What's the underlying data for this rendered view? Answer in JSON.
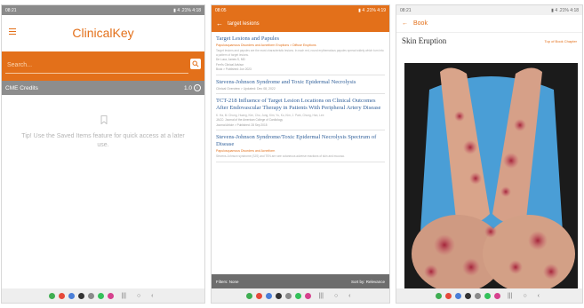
{
  "screen_home": {
    "status_time": "08:21",
    "status_right": "▮ 4 .21% 4:18",
    "title": "ClinicalKey",
    "search_placeholder": "Search...",
    "cme_label": "CME Credits",
    "cme_value": "1.0",
    "tip": "Tip! Use the Saved Items feature for quick access at a later use."
  },
  "screen_results": {
    "status_time": "08:05",
    "status_right": "▮ 4 .21% 4:19",
    "query": "target lesions",
    "results": [
      {
        "title": "Target Lesions and Papules",
        "meta": "Papulosquamous Disorders and Acneiform Eruptions > Diffuse Eruptions",
        "text": "Target lesions and papules are the most characteristic lesions. In each red, round erythematous papules spread widely which turn into a pattern of target lesions.",
        "author": "De Luca, James S, MD",
        "source": "Ferri's Clinical Advisor",
        "date": "Book > Published: Jun 2023"
      },
      {
        "title": "Stevens-Johnson Syndrome and Toxic Epidermal Necrolysis",
        "meta": "Clinical Overview > Updated: Dec 08, 2022"
      },
      {
        "title": "TCT-218 Influence of Target Lesion Locations on Clinical Outcomes After Endovascular Therapy in Patients With Peripheral Artery Disease",
        "text": "K. Ha, M. Chung, Huang, Kim, Cho, Jung, Kim, Yu, Ko, Kim, J. Park, Chung, Han, Lee",
        "source": "JACC: Journal of the American College of Cardiology",
        "date": "Journal Article > Published: 28 Sep 2015"
      },
      {
        "title": "Stevens-Johnson Syndrome/Toxic Epidermal Necrolysis Spectrum of Disease",
        "meta": "Papulosquamous Disorders and Acneiform",
        "text": "Stevens-Johnson syndrome (SJS) and TEN are rare cutaneous adverse reactions of skin and mucosa."
      }
    ],
    "filter_label": "Filters: None",
    "sort_label": "Sort by: Relevance"
  },
  "screen_image": {
    "status_time": "08:21",
    "status_right": "▮ 4 .21% 4:18",
    "back_label": "Book",
    "image_title": "Skin Eruption",
    "chapter_link": "Top of Book Chapter"
  },
  "nav": {
    "recent": "|||",
    "home": "○",
    "back": "‹"
  },
  "colors": {
    "accent": "#e3701a",
    "link_blue": "#2f5f9a"
  }
}
